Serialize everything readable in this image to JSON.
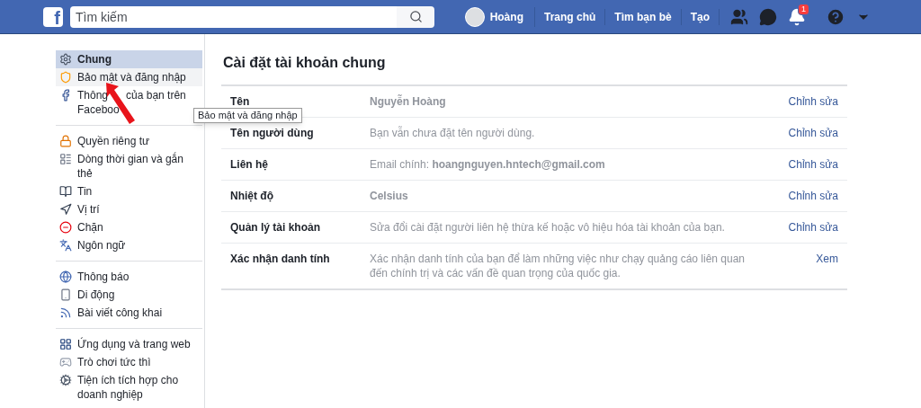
{
  "header": {
    "logo": "f",
    "search": {
      "placeholder": "Tìm kiếm"
    },
    "profile": "Hoàng",
    "nav": [
      "Trang chủ",
      "Tìm bạn bè",
      "Tạo"
    ],
    "notification_badge": "1"
  },
  "sidebar": {
    "sections": [
      {
        "items": [
          {
            "label": "Chung",
            "selected": true,
            "hovered": false
          },
          {
            "label": "Bảo mật và đăng nhập",
            "selected": false,
            "hovered": true
          },
          {
            "label_parts": [
              "Thông",
              "của bạn trên",
              "Faceboo"
            ],
            "selected": false,
            "hovered": false
          }
        ]
      },
      {
        "items": [
          {
            "label": "Quyền riêng tư",
            "selected": false,
            "hovered": false
          },
          {
            "label": "Dòng thời gian và gắn thẻ",
            "selected": false,
            "hovered": false
          },
          {
            "label": "Tin",
            "selected": false,
            "hovered": false
          },
          {
            "label": "Vị trí",
            "selected": false,
            "hovered": false
          },
          {
            "label": "Chặn",
            "selected": false,
            "hovered": false
          },
          {
            "label": "Ngôn ngữ",
            "selected": false,
            "hovered": false
          }
        ]
      },
      {
        "items": [
          {
            "label": "Thông báo",
            "selected": false,
            "hovered": false
          },
          {
            "label": "Di động",
            "selected": false,
            "hovered": false
          },
          {
            "label": "Bài viết công khai",
            "selected": false,
            "hovered": false
          }
        ]
      },
      {
        "items": [
          {
            "label": "Ứng dụng và trang web",
            "selected": false,
            "hovered": false
          },
          {
            "label": "Trò chơi tức thì",
            "selected": false,
            "hovered": false
          },
          {
            "label": "Tiện ích tích hợp cho doanh nghiệp",
            "selected": false,
            "hovered": false
          }
        ]
      }
    ]
  },
  "tooltip": "Bảo mật và đăng nhập",
  "content": {
    "title": "Cài đặt tài khoản chung",
    "rows": [
      {
        "label": "Tên",
        "value": "Nguyễn Hoàng",
        "value_bold": true,
        "action": "Chỉnh sửa"
      },
      {
        "label": "Tên người dùng",
        "value": "Bạn vẫn chưa đặt tên người dùng.",
        "value_bold": false,
        "action": "Chỉnh sửa"
      },
      {
        "label": "Liên hệ",
        "value": "Email chính: **hoangnguyen.hntech@gmail.com**",
        "value_bold": false,
        "action": "Chỉnh sửa"
      },
      {
        "label": "Nhiệt độ",
        "value": "Celsius",
        "value_bold": true,
        "action": "Chỉnh sửa"
      },
      {
        "label": "Quản lý tài khoản",
        "value": "Sửa đổi cài đặt người liên hệ thừa kế hoặc vô hiệu hóa tài khoản của bạn.",
        "value_bold": false,
        "action": "Chỉnh sửa"
      },
      {
        "label": "Xác nhận danh tính",
        "value": "Xác nhận danh tính của bạn để làm những việc như chạy quảng cáo liên quan đến chính trị và các vấn đề quan trọng của quốc gia.",
        "value_bold": false,
        "action": "Xem"
      }
    ]
  }
}
